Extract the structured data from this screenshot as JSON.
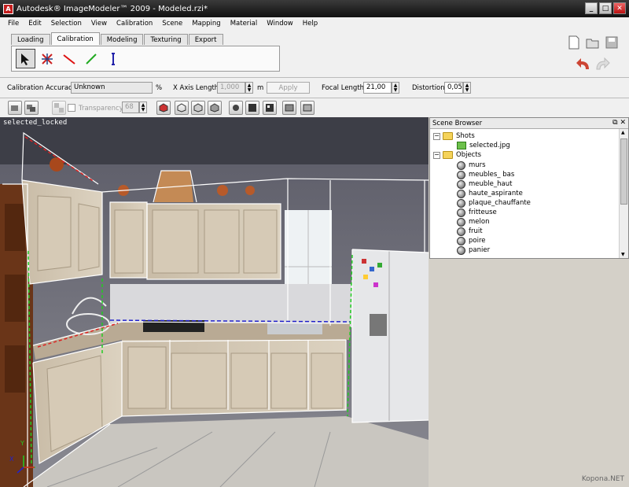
{
  "window": {
    "title": "Autodesk® ImageModeler™ 2009 - Modeled.rzi*",
    "app_icon": "A",
    "min": "_",
    "max": "□",
    "close": "✕"
  },
  "menu": [
    "File",
    "Edit",
    "Selection",
    "View",
    "Calibration",
    "Scene",
    "Mapping",
    "Material",
    "Window",
    "Help"
  ],
  "tabs": [
    "Loading",
    "Calibration",
    "Modeling",
    "Texturing",
    "Export"
  ],
  "active_tab": "Calibration",
  "calibration": {
    "accuracy_label": "Calibration Accuracy",
    "accuracy_value": "Unknown",
    "percent_symbol": "%",
    "xaxis_label": "X Axis Length",
    "xaxis_value": "1,000",
    "unit": "m",
    "apply_label": "Apply",
    "focal_label": "Focal Length",
    "focal_value": "21,00",
    "distortion_label": "Distortion",
    "distortion_value": "0,05"
  },
  "display": {
    "transparency_label": "Transparency",
    "transparency_value": "68"
  },
  "viewport": {
    "label": "selected_locked",
    "axis_y": "Y",
    "axis_x": "X"
  },
  "scene_browser": {
    "title": "Scene Browser",
    "controls": "⧉ ✕",
    "shots_label": "Shots",
    "shot_item": "selected.jpg",
    "objects_label": "Objects",
    "objects": [
      "murs",
      "meubles_ bas",
      "meuble_haut",
      "haute_aspirante",
      "plaque_chauffante",
      "fritteuse",
      "melon",
      "fruit",
      "poire",
      "panier"
    ]
  },
  "watermark": "Kopona.NET",
  "colors": {
    "titlebar": "#1a1a1a",
    "panel": "#f0f0f0",
    "wire": "#ffffff",
    "accent_red": "#c41e1e"
  }
}
